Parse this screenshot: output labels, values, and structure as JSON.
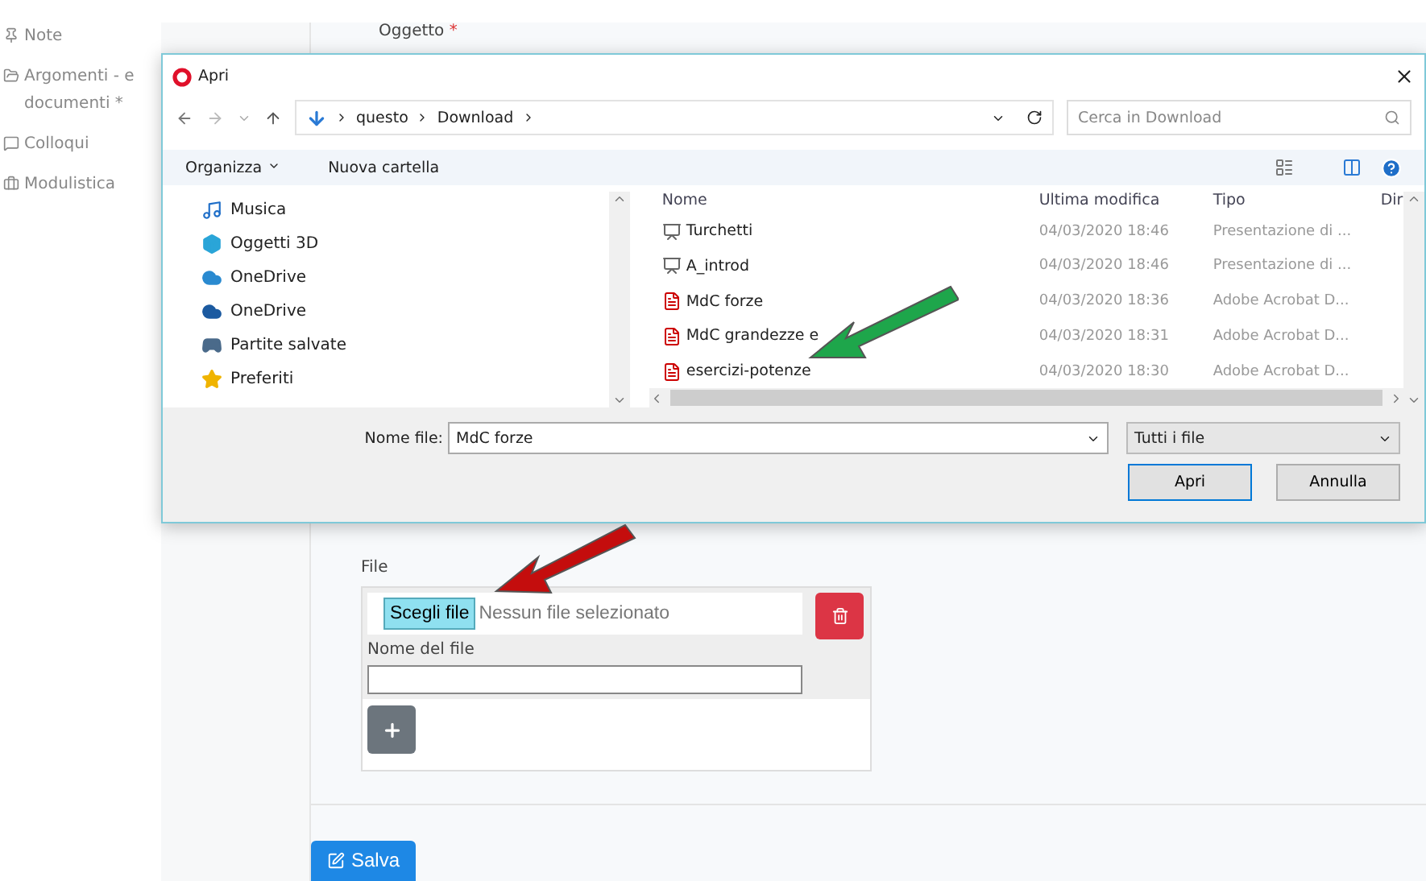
{
  "sidebar": {
    "items": [
      {
        "label": "Note"
      },
      {
        "label": "Argomenti - e documenti *"
      },
      {
        "label": "Colloqui"
      },
      {
        "label": "Modulistica"
      }
    ]
  },
  "form": {
    "subject": {
      "label": "Oggetto",
      "required_mark": "*"
    },
    "file": {
      "label": "File",
      "choose_button": "Scegli file",
      "status": "Nessun file selezionato",
      "name_label": "Nome del file"
    },
    "save_button": "Salva"
  },
  "dialog": {
    "title": "Apri",
    "path": [
      "questo",
      "Download"
    ],
    "search": {
      "placeholder": "Cerca in Download"
    },
    "toolbar": {
      "organize": "Organizza",
      "new_folder": "Nuova cartella"
    },
    "nav_items": [
      {
        "label": "Musica"
      },
      {
        "label": "Oggetti 3D"
      },
      {
        "label": "OneDrive"
      },
      {
        "label": "OneDrive"
      },
      {
        "label": "Partite salvate"
      },
      {
        "label": "Preferiti"
      }
    ],
    "columns": [
      "Nome",
      "Ultima modifica",
      "Tipo",
      "Dir"
    ],
    "files": [
      {
        "kind": "slides",
        "name": "Turchetti",
        "modified": "04/03/2020 18:46",
        "type": "Presentazione di ..."
      },
      {
        "kind": "slides",
        "name": "A_introd",
        "modified": "04/03/2020 18:46",
        "type": "Presentazione di ..."
      },
      {
        "kind": "pdf",
        "name": "MdC forze",
        "modified": "04/03/2020 18:36",
        "type": "Adobe Acrobat D..."
      },
      {
        "kind": "pdf",
        "name": "MdC grandezze e",
        "modified": "04/03/2020 18:31",
        "type": "Adobe Acrobat D..."
      },
      {
        "kind": "pdf",
        "name": "esercizi-potenze",
        "modified": "04/03/2020 18:30",
        "type": "Adobe Acrobat D..."
      }
    ],
    "file_name": {
      "label": "Nome file:",
      "value": "MdC forze"
    },
    "filter": "Tutti i file",
    "buttons": [
      {
        "label": "Apri",
        "default": true
      },
      {
        "label": "Annulla",
        "default": false
      }
    ]
  },
  "annotations": [
    {
      "kind": "arrow",
      "color": "#1ea64b"
    },
    {
      "kind": "arrow",
      "color": "#c40d0d"
    }
  ]
}
